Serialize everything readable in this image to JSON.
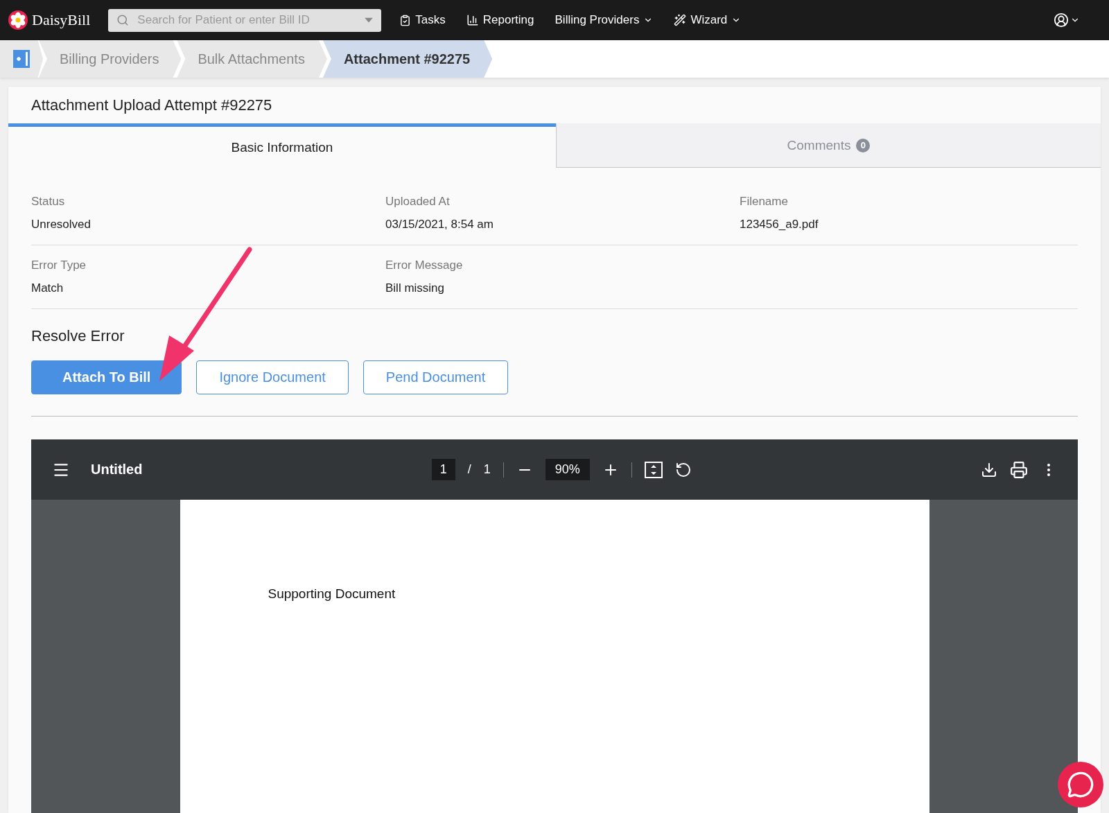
{
  "navbar": {
    "brand": "DaisyBill",
    "search": {
      "placeholder": "Search for Patient or enter Bill ID"
    },
    "items": [
      {
        "label": "Tasks",
        "dropdown": false
      },
      {
        "label": "Reporting",
        "dropdown": false
      },
      {
        "label": "Billing Providers",
        "dropdown": true
      },
      {
        "label": "Wizard",
        "dropdown": true
      }
    ]
  },
  "breadcrumbs": [
    {
      "label": "Billing Providers",
      "selected": false
    },
    {
      "label": "Bulk Attachments",
      "selected": false
    },
    {
      "label": "Attachment #92275",
      "selected": true
    }
  ],
  "card": {
    "title": "Attachment Upload Attempt #92275",
    "tabs": [
      {
        "label": "Basic Information",
        "selected": true
      },
      {
        "label": "Comments",
        "badge": "0",
        "selected": false
      }
    ],
    "field_rows": [
      [
        {
          "label": "Status",
          "value": "Unresolved"
        },
        {
          "label": "Uploaded At",
          "value": "03/15/2021, 8:54 am"
        },
        {
          "label": "Filename",
          "value": "123456_a9.pdf"
        }
      ],
      [
        {
          "label": "Error Type",
          "value": "Match"
        },
        {
          "label": "Error Message",
          "value": "Bill missing"
        }
      ]
    ],
    "resolve": {
      "heading": "Resolve Error",
      "buttons": [
        {
          "label": "Attach To Bill",
          "kind": "primary"
        },
        {
          "label": "Ignore Document",
          "kind": "outline"
        },
        {
          "label": "Pend Document",
          "kind": "outline"
        }
      ]
    },
    "viewer": {
      "title": "Untitled",
      "page": "1",
      "separator": "/",
      "total": "1",
      "zoom": "90%",
      "document_text": "Supporting Document"
    }
  }
}
